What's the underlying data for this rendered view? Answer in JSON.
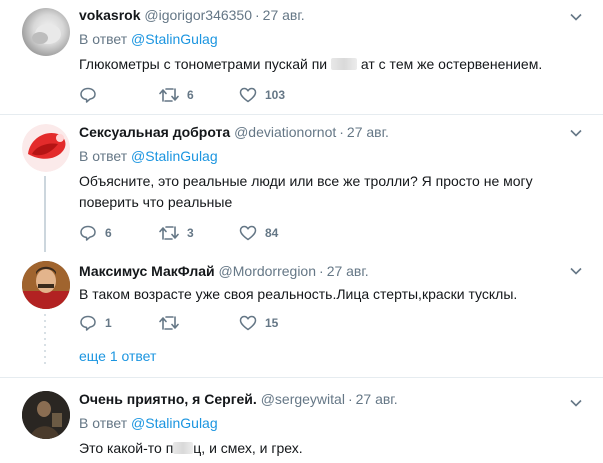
{
  "tweets": [
    {
      "name": "vokasrok",
      "handle": "@igorigor346350",
      "date": "27 авг.",
      "reply_prefix": "В ответ",
      "reply_mention": "@StalinGulag",
      "text_before": "Глюкометры с тонометрами пускай пи",
      "text_after": "ат с тем же остервенением.",
      "replies": "",
      "retweets": "6",
      "likes": "103"
    },
    {
      "name": "Сексуальная доброта",
      "handle": "@deviationornot",
      "date": "27 авг.",
      "reply_prefix": "В ответ",
      "reply_mention": "@StalinGulag",
      "text_line1": "Объясните, это реальные люди или все же тролли? Я просто не могу",
      "text_line2": "поверить что реальные",
      "replies": "6",
      "retweets": "3",
      "likes": "84"
    },
    {
      "name": "Максимус МакФлай",
      "handle": "@Mordorregion",
      "date": "27 авг.",
      "text": "В таком возрасте уже своя реальность.Лица стерты,краски тусклы.",
      "replies": "1",
      "retweets": "",
      "likes": "15"
    },
    {
      "name": "Очень приятно, я Сергей.",
      "handle": "@sergeywital",
      "date": "27 авг.",
      "reply_prefix": "В ответ",
      "reply_mention": "@StalinGulag",
      "text_before": "Это какой-то п",
      "text_after": "ц, и смех, и грех."
    }
  ],
  "more_replies": "еще 1 ответ",
  "colors": {
    "link": "#1b95e0",
    "muted": "#657786",
    "text": "#14171a",
    "divider": "#e6ecf0"
  },
  "icons": [
    "reply-icon",
    "retweet-icon",
    "like-icon",
    "chevron-down-icon"
  ]
}
